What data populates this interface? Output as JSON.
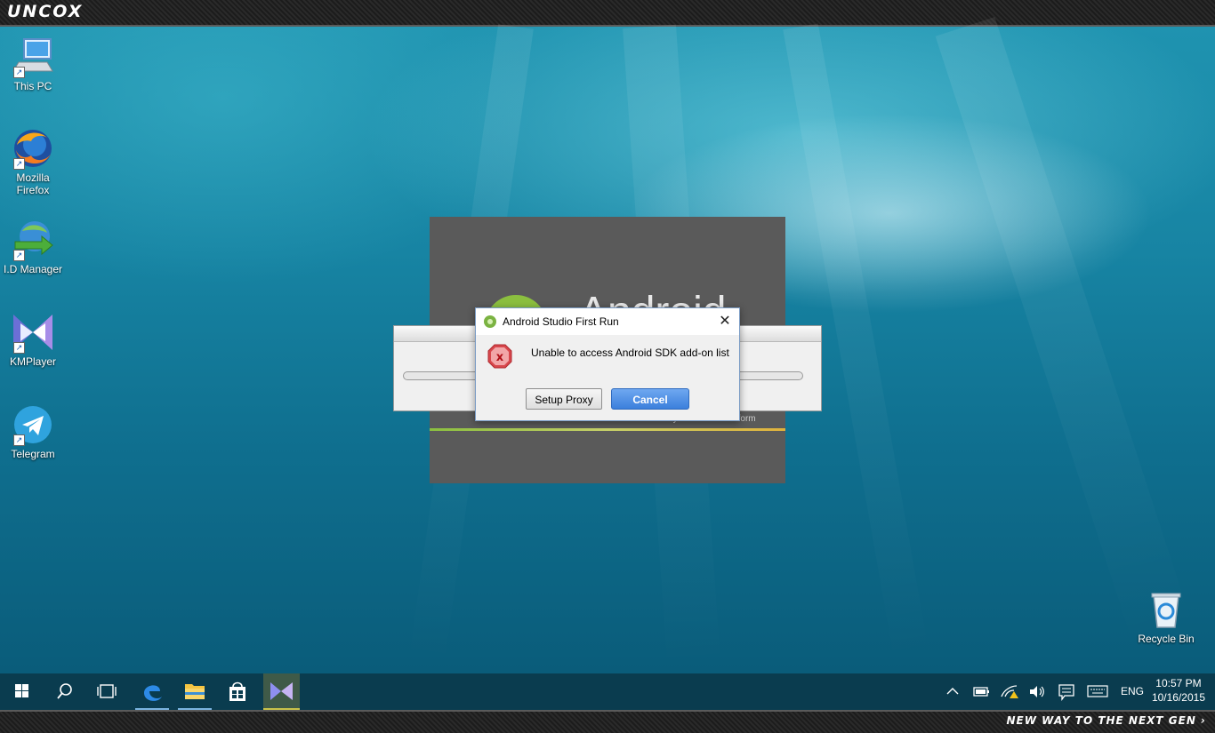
{
  "top_banner": {
    "brand": "UNCOX"
  },
  "desktop_icons": [
    {
      "label": "This PC",
      "icon": "computer-icon"
    },
    {
      "label": "Mozilla\nFirefox",
      "icon": "firefox-icon"
    },
    {
      "label": "I.D Manager",
      "icon": "idm-icon"
    },
    {
      "label": "KMPlayer",
      "icon": "kmplayer-icon"
    },
    {
      "label": "Telegram",
      "icon": "telegram-icon"
    },
    {
      "label": "Recycle Bin",
      "icon": "recycle-bin-icon"
    }
  ],
  "splash": {
    "logo_text": "Android",
    "powered_text": "Powered by the IntelliJ Platform"
  },
  "dialog": {
    "title": "Android Studio First Run",
    "close_glyph": "✕",
    "message": "Unable to access Android SDK add-on list",
    "error_glyph": "x",
    "setup_proxy_label": "Setup Proxy",
    "cancel_label": "Cancel"
  },
  "taskbar": {
    "pinned": [
      "start",
      "search",
      "task-view",
      "edge",
      "file-explorer",
      "store",
      "kmplayer"
    ],
    "language": "ENG",
    "time": "10:57 PM",
    "date": "10/16/2015"
  },
  "bottom_banner": {
    "tagline": "NEW WAY TO THE NEXT GEN ›"
  },
  "colors": {
    "accent_blue": "#3b7fdc",
    "error_red": "#d8474c",
    "android_green": "#8bbf3f",
    "taskbar": "#0a3c4f"
  }
}
